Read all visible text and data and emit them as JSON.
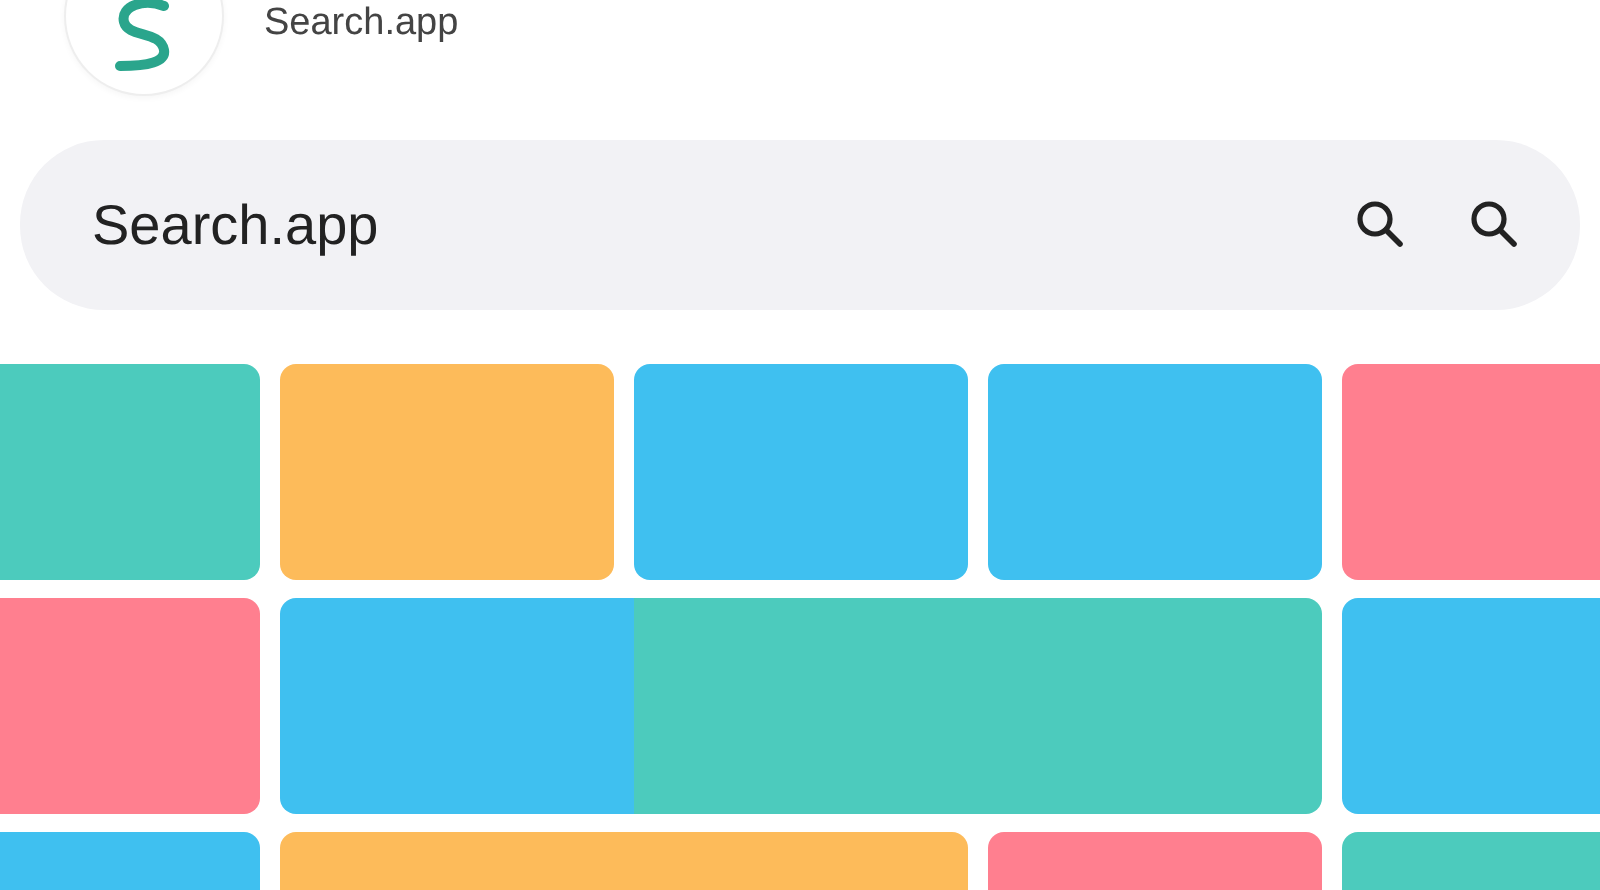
{
  "header": {
    "app_name": "Search.app"
  },
  "search": {
    "value": "Search.app",
    "icons": [
      {
        "kind": "search"
      },
      {
        "kind": "search"
      }
    ]
  },
  "tile_rows": [
    [
      {
        "kind": "single",
        "color": "#4ccbbd"
      },
      {
        "kind": "single",
        "color": "#fdbb5a"
      },
      {
        "kind": "single",
        "color": "#3fc0f0"
      },
      {
        "kind": "single",
        "color": "#3fc0f0"
      },
      {
        "kind": "single",
        "color": "#ff7f8f"
      }
    ],
    [
      {
        "kind": "single",
        "color": "#ff7f8f"
      },
      {
        "kind": "join-left",
        "color": "#3fc0f0"
      },
      {
        "kind": "join-right",
        "color": "#4ccbbd"
      },
      {
        "kind": "single",
        "color": "#3fc0f0"
      }
    ],
    [
      {
        "kind": "single",
        "color": "#3fc0f0"
      },
      {
        "kind": "wide",
        "color": "#fdbb5a"
      },
      {
        "kind": "single",
        "color": "#ff7f8f"
      },
      {
        "kind": "single",
        "color": "#4ccbbd"
      }
    ]
  ]
}
